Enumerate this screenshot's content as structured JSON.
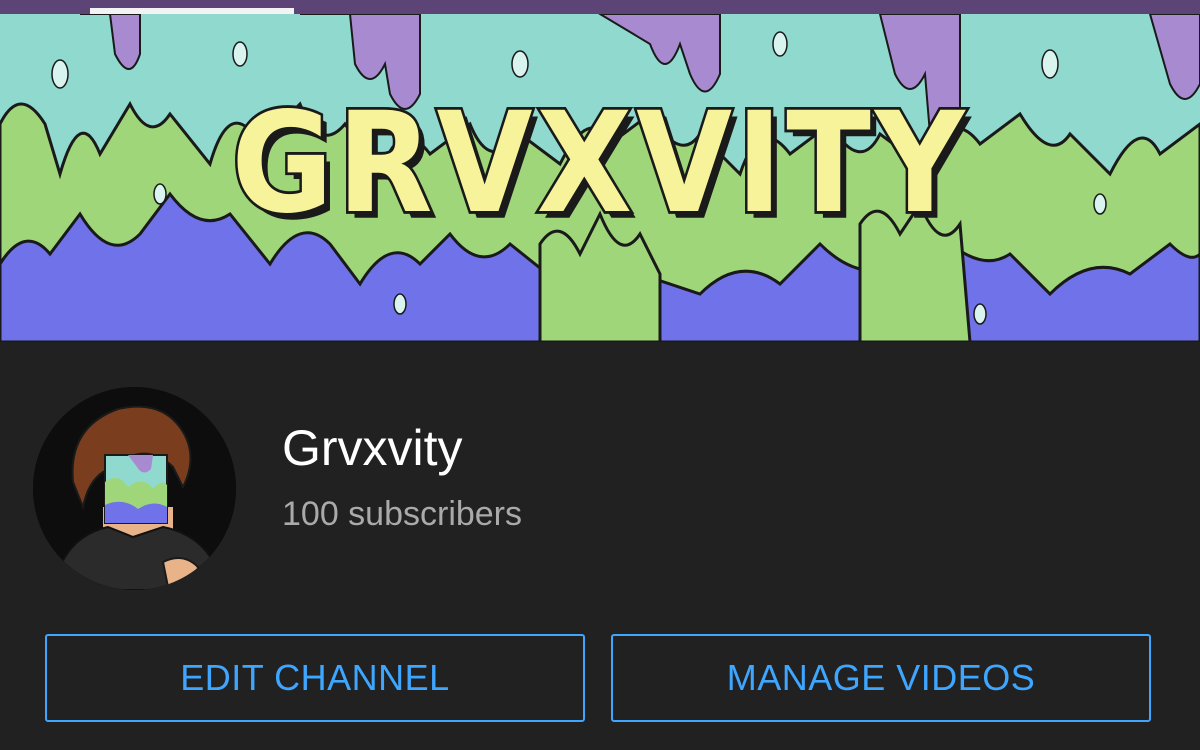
{
  "banner": {
    "title": "GRVXVITY",
    "colors": {
      "mint": "#8fd9cf",
      "green": "#9fd67a",
      "purple": "#a88ad0",
      "blue": "#6f72e8",
      "title_fill": "#f6f39a"
    }
  },
  "channel": {
    "name": "Grvxvity",
    "subscribers": "100 subscribers"
  },
  "actions": {
    "edit_label": "EDIT CHANNEL",
    "manage_label": "MANAGE VIDEOS"
  },
  "theme": {
    "background": "#212121",
    "accent": "#3ea6ff",
    "tab_strip": "#5c4576"
  }
}
